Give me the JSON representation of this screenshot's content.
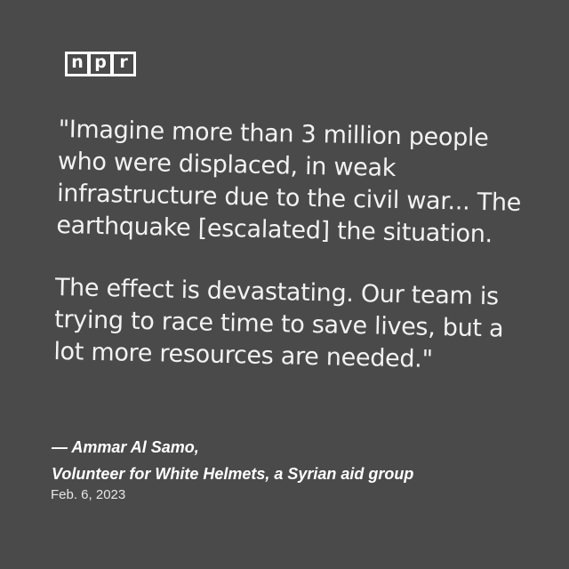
{
  "logo": {
    "letters": [
      "n",
      "p",
      "r"
    ]
  },
  "quote": {
    "paragraph_1": "\"Imagine more than 3 million people who were displaced, in weak infrastructure due to the civil war... The earthquake [escalated] the situation.",
    "paragraph_2": "The effect is devastating. Our team is trying to race time to save lives, but a lot more resources are needed.\""
  },
  "attribution": {
    "name": "— Ammar Al Samo,",
    "role": "Volunteer for White Helmets, a Syrian aid group"
  },
  "date": "Feb. 6, 2023",
  "colors": {
    "background": "#4a4a4a",
    "text": "#ffffff"
  }
}
